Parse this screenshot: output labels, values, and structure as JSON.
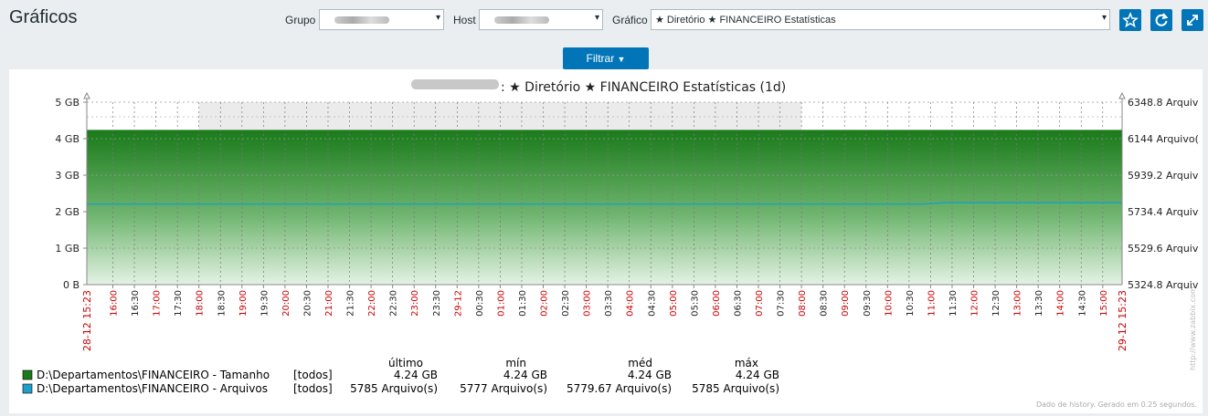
{
  "header": {
    "title": "Gráficos",
    "group_label": "Grupo",
    "host_label": "Host",
    "graph_label": "Gráfico",
    "graph_value": "★ Diretório ★ FINANCEIRO Estatísticas",
    "filter_label": "Filtrar"
  },
  "colors": {
    "accent": "#0275b8",
    "series_size": "#1a7a1a",
    "series_files": "#1e9ec8",
    "red_label": "#cc0000"
  },
  "chart_data": {
    "type": "area",
    "title": ": ★ Diretório ★ FINANCEIRO Estatísticas (1d)",
    "y_left_ticks": [
      "0 B",
      "1 GB",
      "2 GB",
      "3 GB",
      "4 GB",
      "5 GB"
    ],
    "y_right_ticks": [
      "5324.8 Arquiv",
      "5529.6 Arquiv",
      "5734.4 Arquiv",
      "5939.2 Arquiv",
      "6144 Arquivo(",
      "6348.8 Arquiv"
    ],
    "ylim_left": [
      0,
      5
    ],
    "ylim_right": [
      5324.8,
      6348.8
    ],
    "x_start_label": "28-12 15:23",
    "x_end_label": "29-12 15:23",
    "x_ticks": [
      {
        "label": "16:00",
        "red": true
      },
      {
        "label": "16:30",
        "red": false
      },
      {
        "label": "17:00",
        "red": true
      },
      {
        "label": "17:30",
        "red": false
      },
      {
        "label": "18:00",
        "red": true
      },
      {
        "label": "18:30",
        "red": false
      },
      {
        "label": "19:00",
        "red": true
      },
      {
        "label": "19:30",
        "red": false
      },
      {
        "label": "20:00",
        "red": true
      },
      {
        "label": "20:30",
        "red": false
      },
      {
        "label": "21:00",
        "red": true
      },
      {
        "label": "21:30",
        "red": false
      },
      {
        "label": "22:00",
        "red": true
      },
      {
        "label": "22:30",
        "red": false
      },
      {
        "label": "23:00",
        "red": true
      },
      {
        "label": "23:30",
        "red": false
      },
      {
        "label": "29-12",
        "red": true
      },
      {
        "label": "00:30",
        "red": false
      },
      {
        "label": "01:00",
        "red": true
      },
      {
        "label": "01:30",
        "red": false
      },
      {
        "label": "02:00",
        "red": true
      },
      {
        "label": "02:30",
        "red": false
      },
      {
        "label": "03:00",
        "red": true
      },
      {
        "label": "03:30",
        "red": false
      },
      {
        "label": "04:00",
        "red": true
      },
      {
        "label": "04:30",
        "red": false
      },
      {
        "label": "05:00",
        "red": true
      },
      {
        "label": "05:30",
        "red": false
      },
      {
        "label": "06:00",
        "red": true
      },
      {
        "label": "06:30",
        "red": false
      },
      {
        "label": "07:00",
        "red": true
      },
      {
        "label": "07:30",
        "red": false
      },
      {
        "label": "08:00",
        "red": true
      },
      {
        "label": "08:30",
        "red": false
      },
      {
        "label": "09:00",
        "red": true
      },
      {
        "label": "09:30",
        "red": false
      },
      {
        "label": "10:00",
        "red": true
      },
      {
        "label": "10:30",
        "red": false
      },
      {
        "label": "11:00",
        "red": true
      },
      {
        "label": "11:30",
        "red": false
      },
      {
        "label": "12:00",
        "red": true
      },
      {
        "label": "12:30",
        "red": false
      },
      {
        "label": "13:00",
        "red": true
      },
      {
        "label": "13:30",
        "red": false
      },
      {
        "label": "14:00",
        "red": true
      },
      {
        "label": "14:30",
        "red": false
      },
      {
        "label": "15:00",
        "red": true
      }
    ],
    "series": [
      {
        "name": "D:\\Departamentos\\FINANCEIRO - Tamanho",
        "axis": "left",
        "value": 4.24
      },
      {
        "name": "D:\\Departamentos\\FINANCEIRO - Arquivos",
        "axis": "right",
        "values": [
          5777,
          5777,
          5785,
          5785
        ]
      }
    ],
    "legend": {
      "headers": [
        "último",
        "mín",
        "méd",
        "máx"
      ],
      "rows": [
        {
          "scope": "[todos]",
          "last": "4.24 GB",
          "min": "4.24 GB",
          "avg": "4.24 GB",
          "max": "4.24 GB"
        },
        {
          "scope": "[todos]",
          "last": "5785 Arquivo(s)",
          "min": "5777 Arquivo(s)",
          "avg": "5779.67 Arquivo(s)",
          "max": "5785 Arquivo(s)"
        }
      ]
    },
    "footer": "Dado de history. Gerado em 0.25 segundos.",
    "watermark": "http://www.zabbix.com"
  }
}
